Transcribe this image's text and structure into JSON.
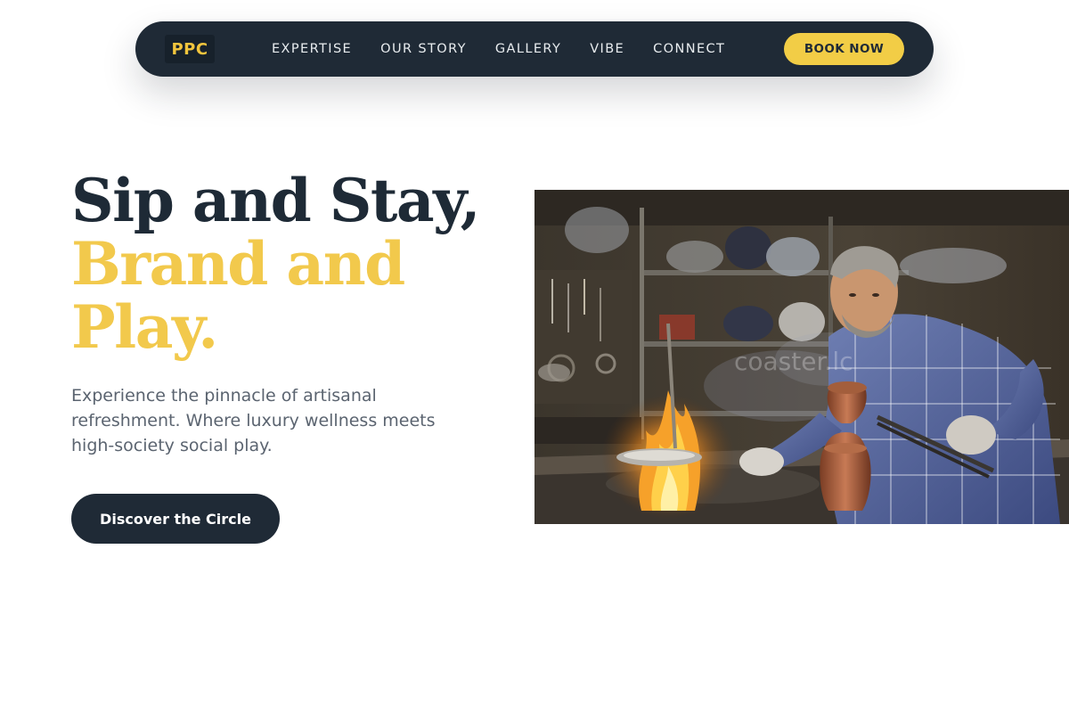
{
  "nav": {
    "logo": "PPC",
    "links": [
      "EXPERTISE",
      "OUR STORY",
      "GALLERY",
      "VIBE",
      "CONNECT"
    ],
    "cta": "BOOK NOW"
  },
  "hero": {
    "headline_line1": "Sip and Stay,",
    "headline_line2": "Brand and",
    "headline_line3": "Play.",
    "subtitle": "Experience the pinnacle of artisanal refreshment. Where luxury wellness meets high-society social play.",
    "cta": "Discover the Circle",
    "image_watermark": "coaster.lc"
  },
  "colors": {
    "navy": "#1f2a36",
    "gold": "#f2c94c",
    "text_muted": "#5b6470",
    "background": "#ffffff"
  }
}
